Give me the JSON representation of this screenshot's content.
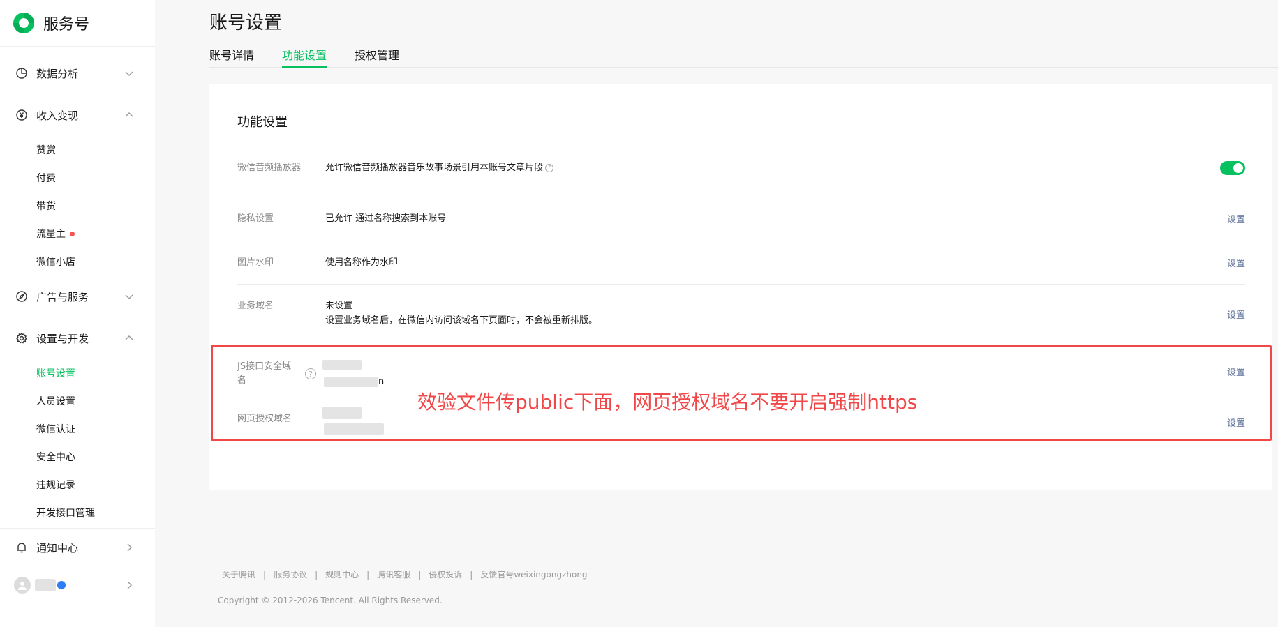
{
  "sidebar": {
    "brand": "服务号",
    "groups": {
      "data_analysis": "数据分析",
      "monetization": "收入变现",
      "ads": "广告与服务",
      "settings_dev": "设置与开发",
      "notifications": "通知中心"
    },
    "monetization_items": [
      "赞赏",
      "付费",
      "带货",
      "流量主",
      "微信小店"
    ],
    "settings_items": [
      "账号设置",
      "人员设置",
      "微信认证",
      "安全中心",
      "违规记录",
      "开发接口管理"
    ]
  },
  "page": {
    "title": "账号设置",
    "tabs": [
      "账号详情",
      "功能设置",
      "授权管理"
    ],
    "active_tab": "功能设置"
  },
  "card": {
    "title": "功能设置",
    "rows": {
      "audio": {
        "label": "微信音频播放器",
        "value": "允许微信音频播放器音乐故事场景引用本账号文章片段",
        "toggle_on": true
      },
      "privacy": {
        "label": "隐私设置",
        "value": "已允许 通过名称搜索到本账号",
        "action": "设置"
      },
      "watermark": {
        "label": "图片水印",
        "value": "使用名称作为水印",
        "action": "设置"
      },
      "biz_domain": {
        "label": "业务域名",
        "value": "未设置",
        "desc": "设置业务域名后，在微信内访问该域名下页面时，不会被重新排版。",
        "action": "设置"
      },
      "js_domain": {
        "label": "JS接口安全域名",
        "value_tail": "n",
        "action": "设置"
      },
      "oauth_domain": {
        "label": "网页授权域名",
        "action": "设置"
      }
    }
  },
  "annotation": "效验文件传public下面，网页授权域名不要开启强制https",
  "footer": {
    "links": [
      "关于腾讯",
      "服务协议",
      "规则中心",
      "腾讯客服",
      "侵权投诉",
      "反馈官号weixingongzhong"
    ],
    "copyright": "Copyright © 2012-2026 Tencent. All Rights Reserved."
  },
  "colors": {
    "accent": "#07c160",
    "link": "#576b95",
    "annotation": "#f04848"
  }
}
